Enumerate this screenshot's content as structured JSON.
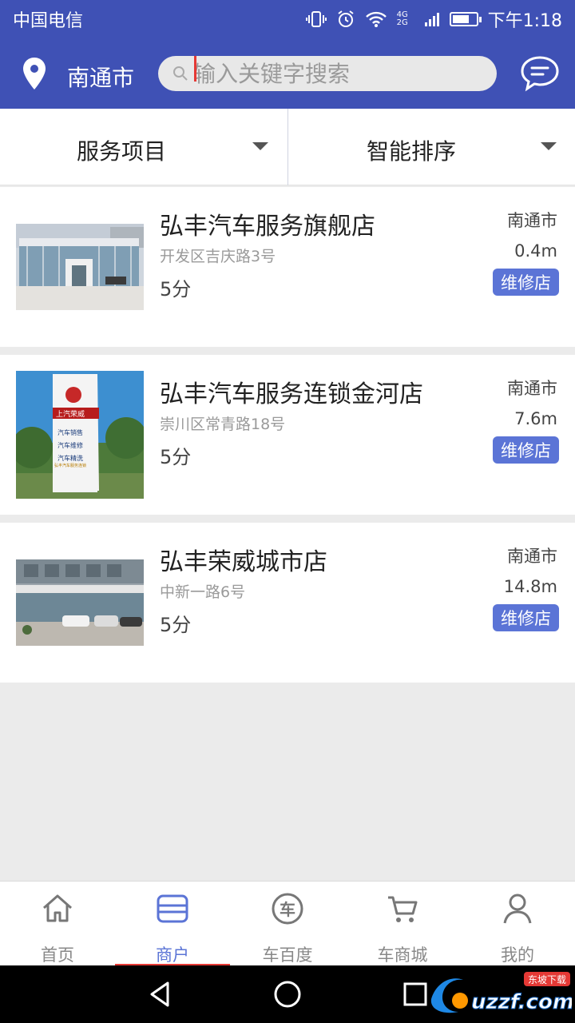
{
  "status_bar": {
    "carrier": "中国电信",
    "time": "下午1:18",
    "network": "4G 2G"
  },
  "header": {
    "city": "南通市",
    "search_placeholder": "输入关键字搜索",
    "search_icon": "search-icon",
    "location_icon": "location-pin-icon",
    "message_icon": "message-bubble-icon"
  },
  "filters": {
    "service": "服务项目",
    "sort": "智能排序"
  },
  "shops": [
    {
      "name": "弘丰汽车服务旗舰店",
      "address": "开发区吉庆路3号",
      "score": "5分",
      "city": "南通市",
      "distance": "0.4m",
      "tag": "维修店"
    },
    {
      "name": "弘丰汽车服务连锁金河店",
      "address": "崇川区常青路18号",
      "score": "5分",
      "city": "南通市",
      "distance": "7.6m",
      "tag": "维修店",
      "sign_texts": [
        "上汽荣威",
        "汽车销售",
        "汽车维修",
        "汽车精洗",
        "弘丰汽车服务连锁"
      ]
    },
    {
      "name": "弘丰荣威城市店",
      "address": "中新一路6号",
      "score": "5分",
      "city": "南通市",
      "distance": "14.8m",
      "tag": "维修店"
    }
  ],
  "bottom_nav": [
    {
      "label": "首页",
      "icon": "home-icon"
    },
    {
      "label": "商户",
      "icon": "shop-icon",
      "active": true
    },
    {
      "label": "车百度",
      "icon": "car-char-icon"
    },
    {
      "label": "车商城",
      "icon": "cart-icon"
    },
    {
      "label": "我的",
      "icon": "user-icon"
    }
  ],
  "watermark": "uzzf.com",
  "watermark_sub": "东坡下载",
  "colors": {
    "primary": "#3f51b5",
    "accent": "#5b74d6",
    "active_indicator": "#e53935"
  }
}
